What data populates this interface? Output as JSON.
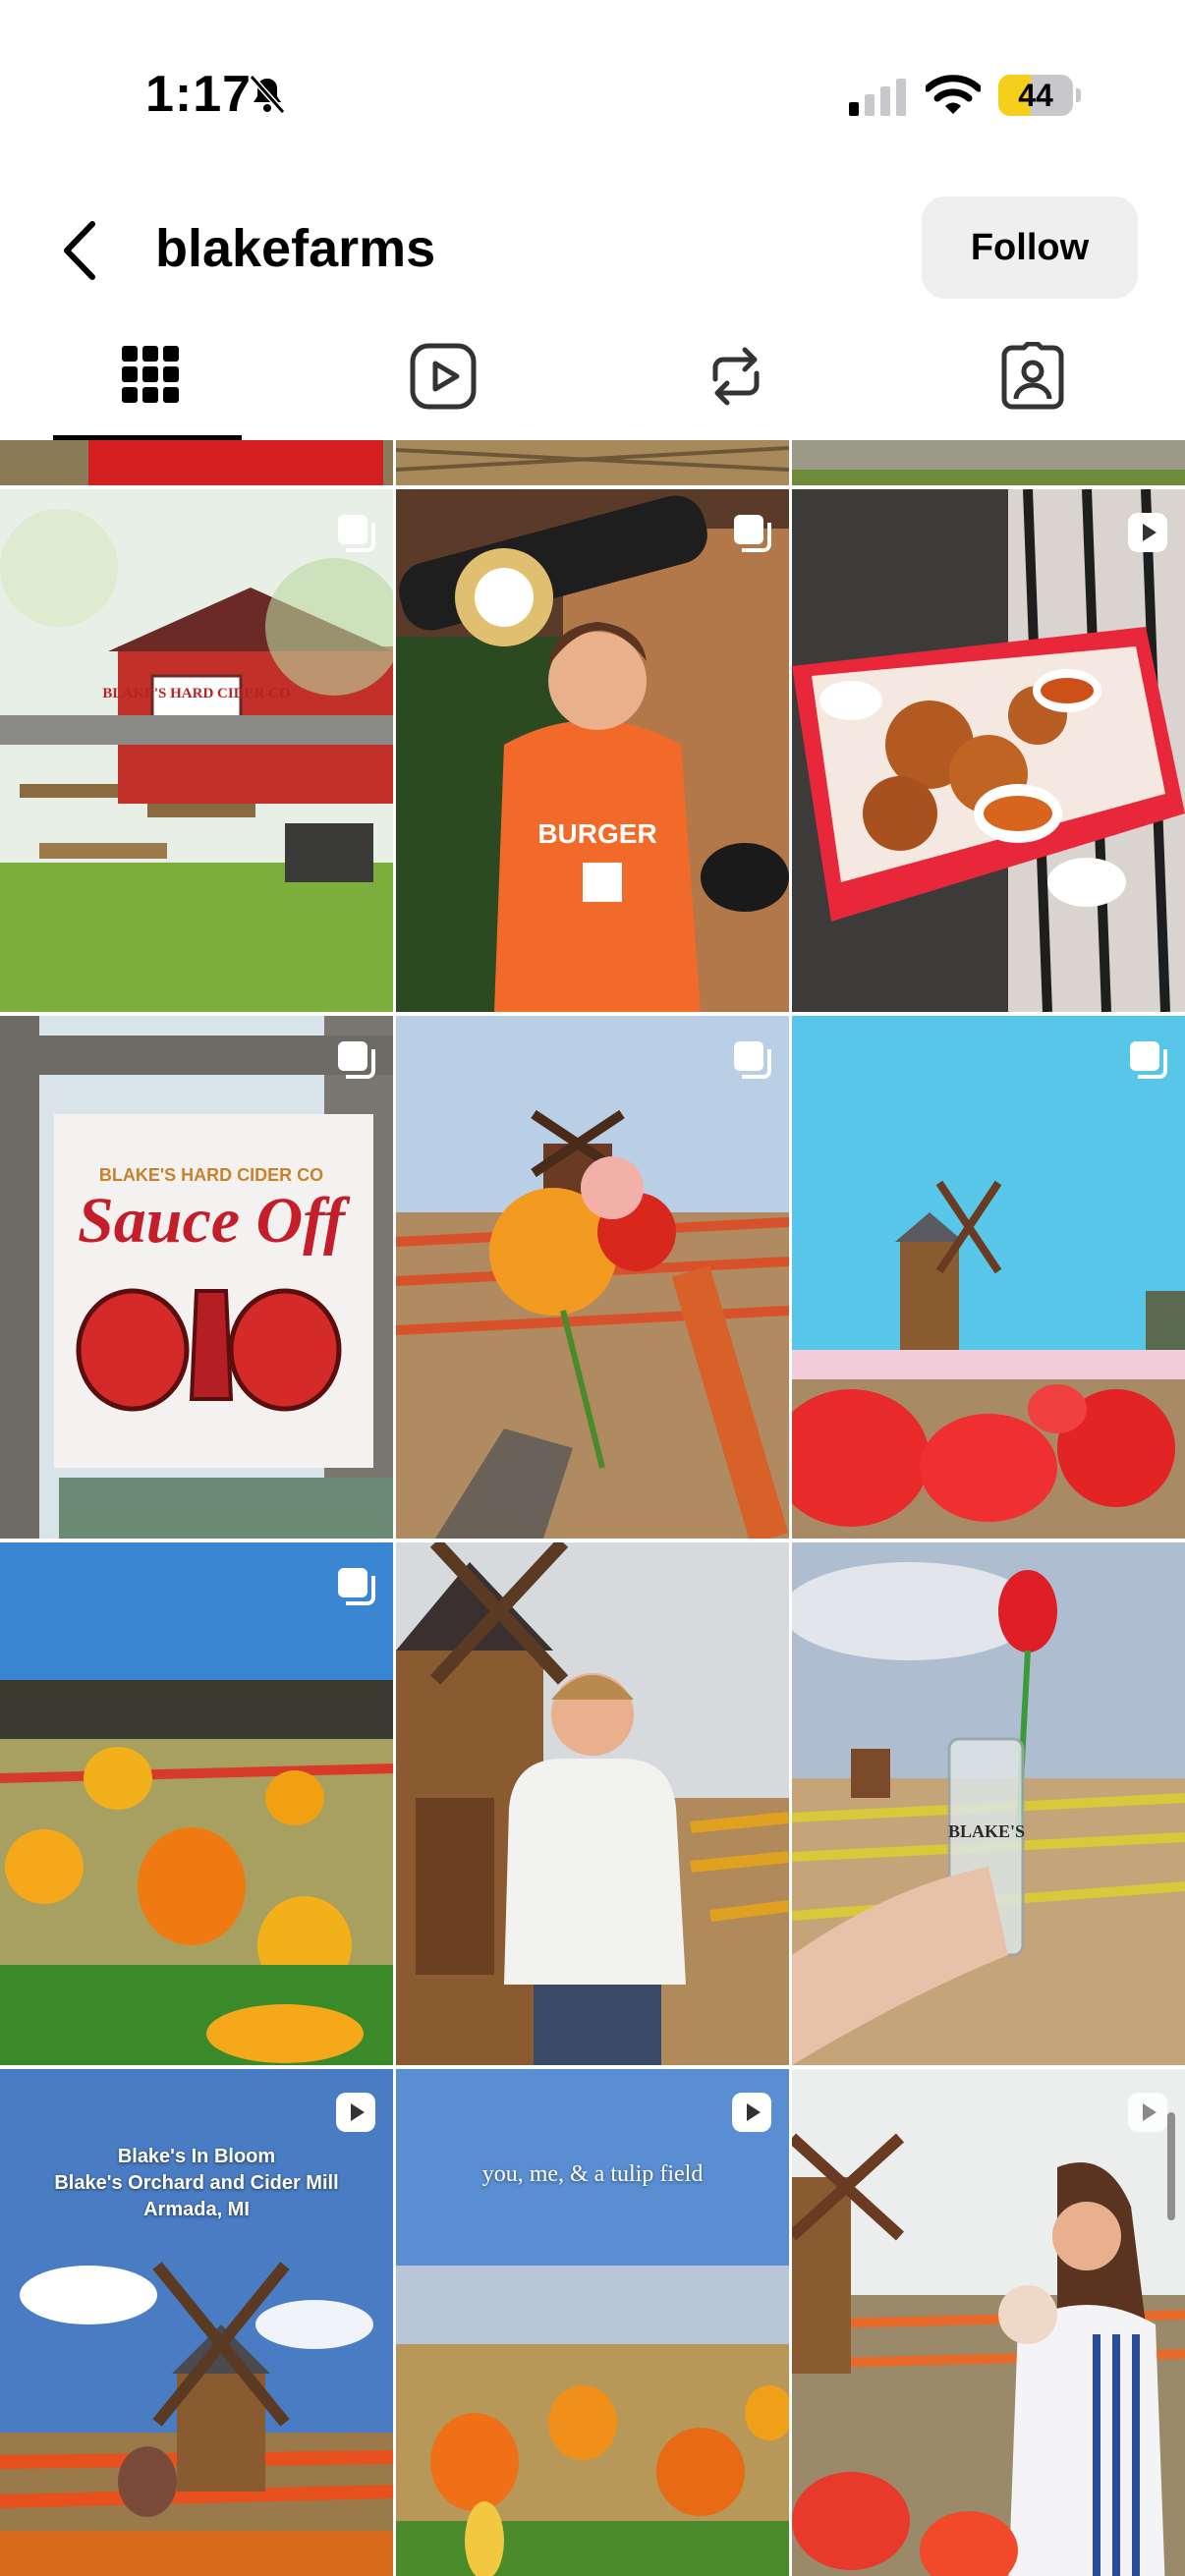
{
  "status_bar": {
    "time": "1:17",
    "battery": "44",
    "battery_level": 0.44,
    "icons": [
      "bell-slash-icon",
      "cellular-signal-icon",
      "wifi-icon",
      "battery-icon"
    ]
  },
  "header": {
    "username": "blakefarms",
    "follow_label": "Follow",
    "back_icon": "chevron-left-icon"
  },
  "tabs": [
    {
      "name": "posts",
      "icon": "grid-icon",
      "active": true
    },
    {
      "name": "reels",
      "icon": "reels-icon",
      "active": false
    },
    {
      "name": "reposts",
      "icon": "repost-icon",
      "active": false
    },
    {
      "name": "tagged",
      "icon": "tagged-icon",
      "active": false
    }
  ],
  "posts": [
    {
      "type": "carousel"
    },
    {
      "type": "carousel"
    },
    {
      "type": "reel"
    },
    {
      "type": "carousel"
    },
    {
      "type": "carousel"
    },
    {
      "type": "carousel"
    },
    {
      "type": "carousel"
    },
    {
      "type": "photo"
    },
    {
      "type": "photo"
    },
    {
      "type": "reel",
      "caption_lines": [
        "Blake's In Bloom",
        "Blake's Orchard and Cider Mill",
        "Armada, MI"
      ]
    },
    {
      "type": "reel",
      "caption": "you, me, & a tulip field"
    },
    {
      "type": "reel"
    }
  ],
  "image_text": {
    "cider_sign": "BLAKE'S HARD CIDER CO",
    "sauce_banner_top": "BLAKE'S HARD CIDER CO",
    "sauce_banner": "Sauce Off",
    "shirt_text": "BURGER",
    "glass_text": "BLAKE'S"
  },
  "colors": {
    "accent": "#000000",
    "follow_bg": "#efefef",
    "battery": "#f5cf1b"
  }
}
